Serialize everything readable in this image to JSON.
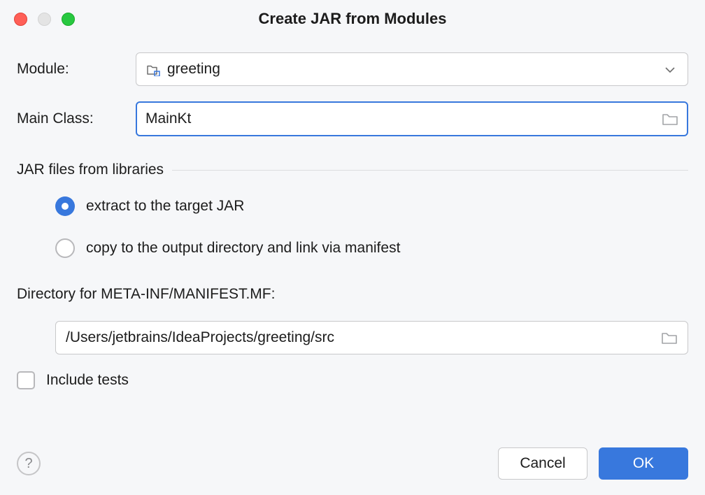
{
  "window": {
    "title": "Create JAR from Modules"
  },
  "form": {
    "module_label": "Module:",
    "module_value": "greeting",
    "main_class_label": "Main Class:",
    "main_class_value": "MainKt",
    "libs_section_label": "JAR files from libraries",
    "radio_extract": "extract to the target JAR",
    "radio_copy": "copy to the output directory and link via manifest",
    "radio_selected": "extract",
    "manifest_dir_label": "Directory for META-INF/MANIFEST.MF:",
    "manifest_dir_value": "/Users/jetbrains/IdeaProjects/greeting/src",
    "include_tests_label": "Include tests",
    "include_tests_checked": false
  },
  "footer": {
    "cancel_label": "Cancel",
    "ok_label": "OK"
  }
}
